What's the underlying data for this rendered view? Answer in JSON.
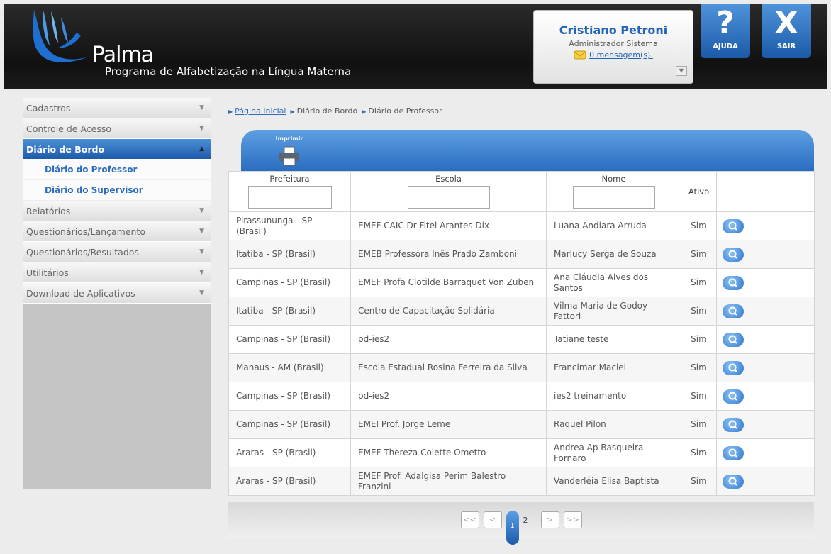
{
  "header": {
    "logo_name": "Palma",
    "logo_subtitle": "Programa de Alfabetização na Língua Materna",
    "user_name": "Cristiano Petroni",
    "user_role": "Administrador Sistema",
    "messages_link": "0 mensagem(s).",
    "user_toggle_icon": "▼",
    "help_label": "AJUDA",
    "exit_label": "SAIR",
    "help_glyph": "?",
    "exit_glyph": "X"
  },
  "sidebar": {
    "items": [
      {
        "label": "Cadastros",
        "arrow": "▼"
      },
      {
        "label": "Controle de Acesso",
        "arrow": "▼"
      },
      {
        "label": "Diário de Bordo",
        "arrow": "▲"
      },
      {
        "label": "Relatórios",
        "arrow": "▼"
      },
      {
        "label": "Questionários/Lançamento",
        "arrow": "▼"
      },
      {
        "label": "Questionários/Resultados",
        "arrow": "▼"
      },
      {
        "label": "Utilitários",
        "arrow": "▼"
      },
      {
        "label": "Download de Aplicativos",
        "arrow": "▼"
      }
    ],
    "subitems": [
      "Diário do Professor",
      "Diário do Supervisor"
    ]
  },
  "breadcrumb": [
    "Página Inicial",
    "Diário de Bordo",
    "Diário de Professor"
  ],
  "toolbar": {
    "print_label": "Imprimir"
  },
  "table": {
    "headers": [
      "Prefeitura",
      "Escola",
      "Nome",
      "Ativo"
    ],
    "rows": [
      [
        "Pirassununga - SP (Brasil)",
        "EMEF CAIC Dr Fitel Arantes Dix",
        "Luana Andiara Arruda",
        "Sim"
      ],
      [
        "Itatiba - SP (Brasil)",
        "EMEB Professora Inês Prado Zamboni",
        "Marlucy Serga de Souza",
        "Sim"
      ],
      [
        "Campinas - SP (Brasil)",
        "EMEF Profa Clotilde Barraquet Von Zuben",
        "Ana Cláudia Alves dos Santos",
        "Sim"
      ],
      [
        "Itatiba - SP (Brasil)",
        "Centro de Capacitação Solidária",
        "Vilma Maria de Godoy Fattori",
        "Sim"
      ],
      [
        "Campinas - SP (Brasil)",
        "pd-ies2",
        "Tatiane teste",
        "Sim"
      ],
      [
        "Manaus - AM (Brasil)",
        "Escola Estadual Rosina Ferreira da Silva",
        "Francimar Maciel",
        "Sim"
      ],
      [
        "Campinas - SP (Brasil)",
        "pd-ies2",
        "ies2 treinamento",
        "Sim"
      ],
      [
        "Campinas - SP (Brasil)",
        "EMEI Prof. Jorge Leme",
        "Raquel Pilon",
        "Sim"
      ],
      [
        "Araras - SP (Brasil)",
        "EMEF Thereza Colette Ometto",
        "Andrea Ap Basqueira Fornaro",
        "Sim"
      ],
      [
        "Araras - SP (Brasil)",
        "EMEF Prof. Adalgisa Perim Balestro Franzini",
        "Vanderléia Elisa Baptista",
        "Sim"
      ]
    ]
  },
  "pager": {
    "first": "<<",
    "prev": "<",
    "current": "1",
    "next_page": "2",
    "next": ">",
    "last": ">>"
  },
  "colors": {
    "accent": "#2c6cc0",
    "header_bg": "#1a1a1a"
  }
}
